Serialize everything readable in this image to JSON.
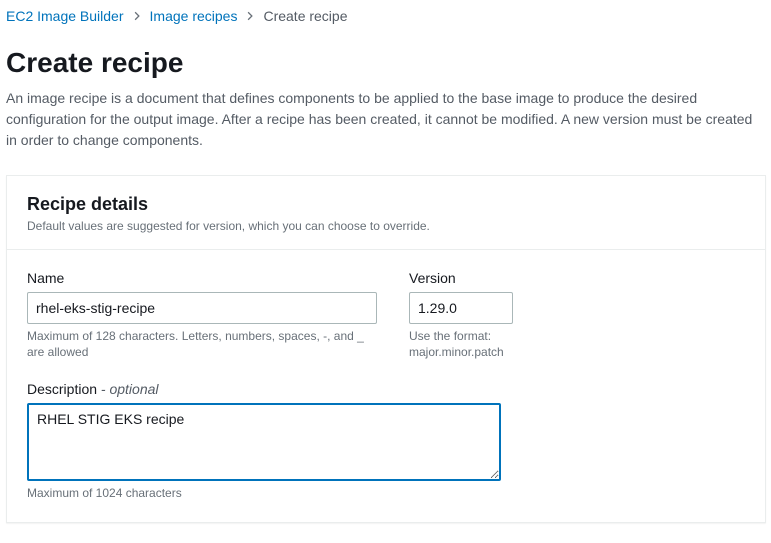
{
  "breadcrumb": {
    "root": "EC2 Image Builder",
    "level1": "Image recipes",
    "current": "Create recipe"
  },
  "header": {
    "title": "Create recipe",
    "description": "An image recipe is a document that defines components to be applied to the base image to produce the desired configuration for the output image. After a recipe has been created, it cannot be modified. A new version must be created in order to change components."
  },
  "panel": {
    "title": "Recipe details",
    "subtitle": "Default values are suggested for version, which you can choose to override."
  },
  "form": {
    "name_label": "Name",
    "name_value": "rhel-eks-stig-recipe",
    "name_hint": "Maximum of 128 characters. Letters, numbers, spaces, -, and _ are allowed",
    "version_label": "Version",
    "version_value": "1.29.0",
    "version_hint": "Use the format: major.minor.patch",
    "description_label": "Description",
    "description_optional": " - optional",
    "description_value": "RHEL STIG EKS recipe",
    "description_hint": "Maximum of 1024 characters"
  }
}
